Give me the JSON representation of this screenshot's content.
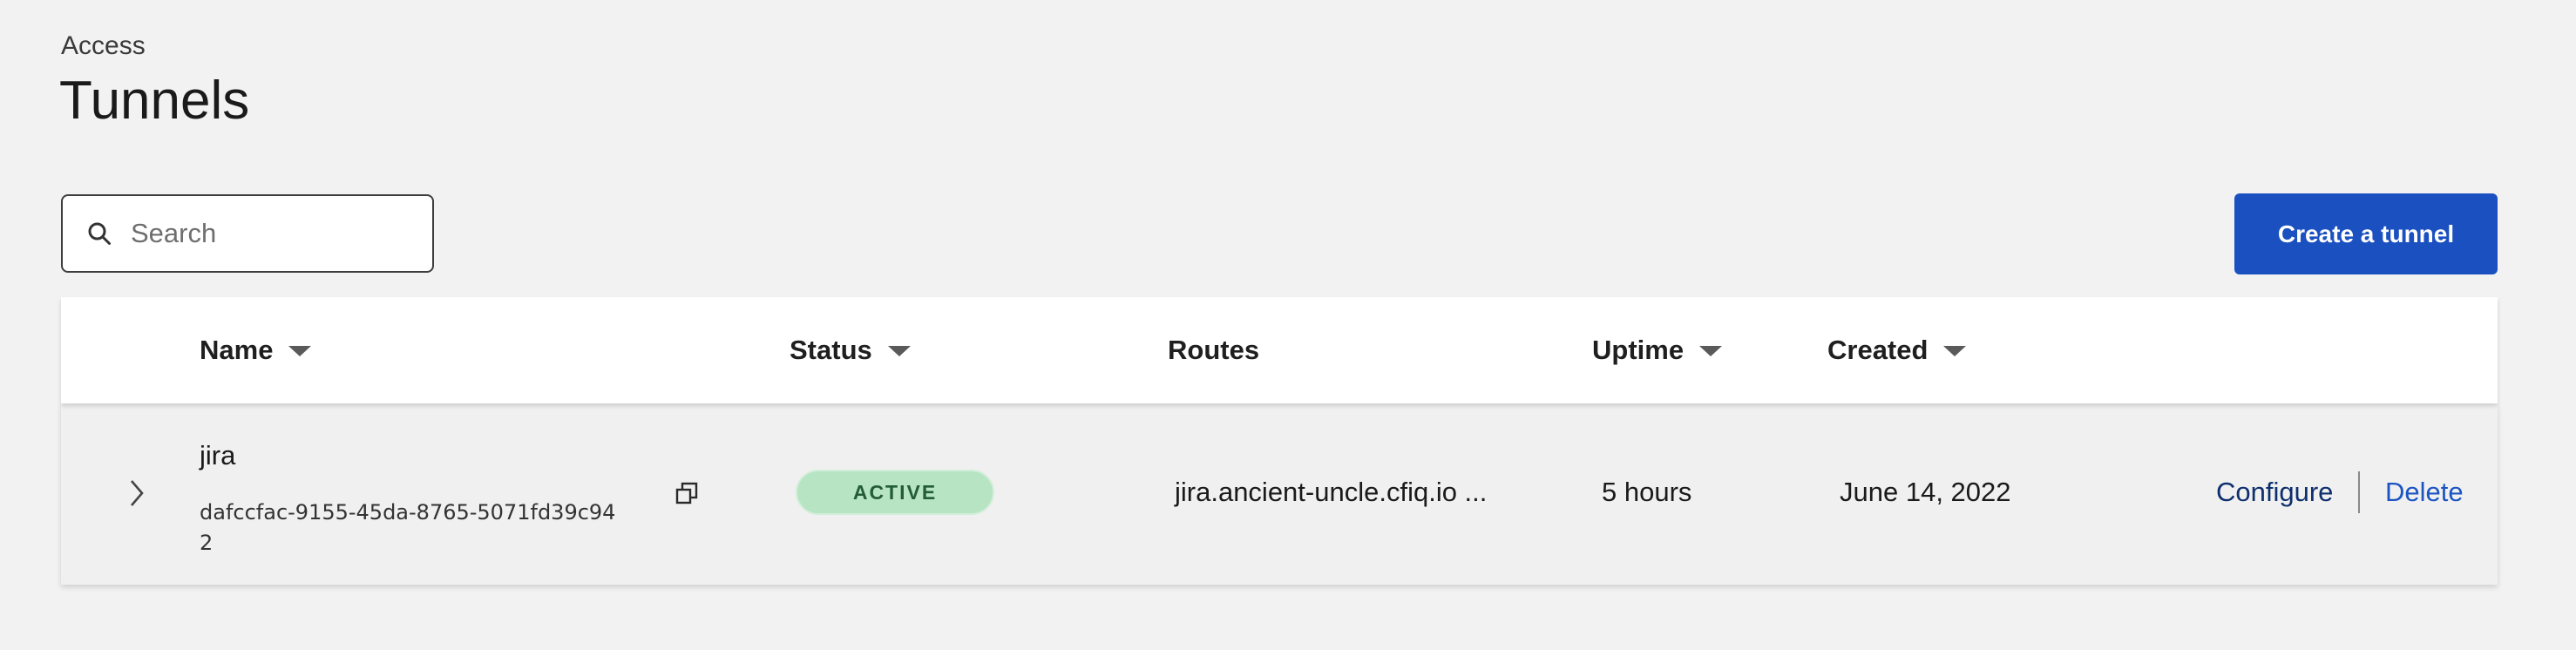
{
  "header": {
    "breadcrumb": "Access",
    "title": "Tunnels"
  },
  "toolbar": {
    "search_placeholder": "Search",
    "search_value": "",
    "create_label": "Create a tunnel",
    "create_color": "#1a50c0"
  },
  "table": {
    "columns": {
      "name": "Name",
      "status": "Status",
      "routes": "Routes",
      "uptime": "Uptime",
      "created": "Created"
    },
    "sortable_columns": [
      "name",
      "status",
      "uptime",
      "created"
    ],
    "rows": [
      {
        "name": "jira",
        "id": "dafccfac-9155-45da-8765-5071fd39c942",
        "status": "ACTIVE",
        "status_color": "#b7e4c3",
        "routes": "jira.ancient-uncle.cfiq.io ...",
        "uptime": "5 hours",
        "created": "June 14, 2022",
        "actions": {
          "configure": "Configure",
          "delete": "Delete"
        }
      }
    ]
  },
  "icons": {
    "search": "search-icon",
    "sort": "caret-down-icon",
    "expand": "chevron-right-icon",
    "copy": "copy-icon"
  }
}
